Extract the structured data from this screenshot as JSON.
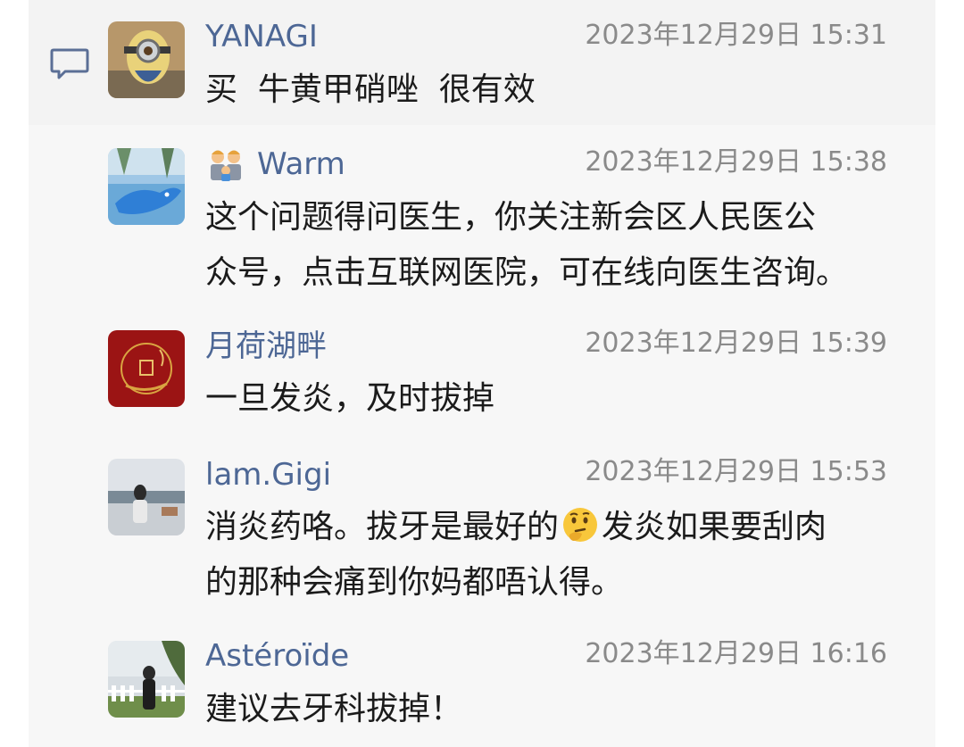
{
  "thread": {
    "comments": [
      {
        "name": "YANAGI",
        "time": "2023年12月29日 15:31",
        "lines": [
          "买  牛黄甲硝唑  很有效"
        ]
      },
      {
        "name": "Warm",
        "time": "2023年12月29日 15:38",
        "lines": [
          "这个问题得问医生，你关注新会区人民医公",
          "众号，点击互联网医院，可在线向医生咨询。"
        ]
      },
      {
        "name": "月荷湖畔",
        "time": "2023年12月29日 15:39",
        "lines": [
          "一旦发炎，及时拔掉"
        ]
      },
      {
        "name": "lam.Gigi",
        "time": "2023年12月29日 15:53",
        "line1_before": "消炎药咯。拔牙是最好的",
        "line1_after": "发炎如果要刮肉",
        "line2": "的那种会痛到你妈都唔认得。"
      },
      {
        "name": "Astéroïde",
        "time": "2023年12月29日 16:16",
        "lines": [
          "建议去牙科拔掉！"
        ]
      }
    ]
  },
  "colors": {
    "name": "#4d6795",
    "time": "#8a8a8a",
    "text": "#1b1b1b",
    "background": "#f7f7f7"
  },
  "icons": {
    "comment": "comment-bubble-icon",
    "badge": "couple-emoji-icon",
    "inline_emoji": "thinking-face-emoji"
  }
}
